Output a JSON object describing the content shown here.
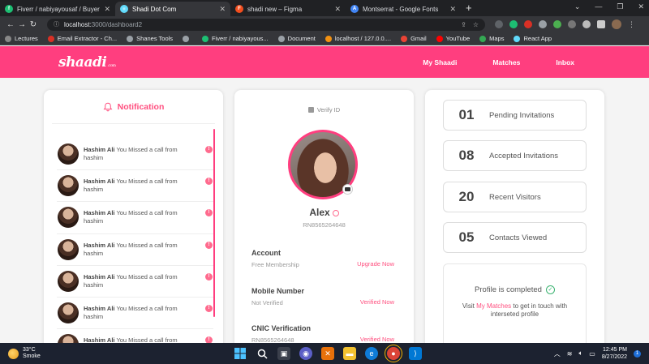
{
  "browser": {
    "tabs": [
      {
        "title": "Fiverr / nabiyayousaf / Buyer Rep",
        "icon": "fiverr-icon",
        "color": "#1dbf73",
        "glyph": "f",
        "active": false
      },
      {
        "title": "Shadi Dot Com",
        "icon": "react-icon",
        "color": "#61dafb",
        "glyph": "⚛",
        "active": true
      },
      {
        "title": "shadi new – Figma",
        "icon": "figma-icon",
        "color": "#f24e1e",
        "glyph": "F",
        "active": false
      },
      {
        "title": "Montserrat - Google Fonts",
        "icon": "google-fonts-icon",
        "color": "#4285f4",
        "glyph": "A",
        "active": false
      }
    ],
    "url_host": "localhost:",
    "url_path": "3000/dashboard2",
    "bookmarks": [
      {
        "label": "Lectures",
        "color": "#888"
      },
      {
        "label": "Email Extractor - Ch...",
        "color": "#d93025"
      },
      {
        "label": "Shanes Tools",
        "color": "#9aa0a6"
      },
      {
        "label": "",
        "color": "#9aa0a6"
      },
      {
        "label": "Fiverr / nabiyayous...",
        "color": "#1dbf73"
      },
      {
        "label": "Document",
        "color": "#9aa0a6"
      },
      {
        "label": "localhost / 127.0.0....",
        "color": "#f29111"
      },
      {
        "label": "Gmail",
        "color": "#ea4335"
      },
      {
        "label": "YouTube",
        "color": "#ff0000"
      },
      {
        "label": "Maps",
        "color": "#34a853"
      },
      {
        "label": "React App",
        "color": "#61dafb"
      }
    ]
  },
  "app": {
    "logo": "shaadi",
    "logo_suffix": ".com",
    "nav": [
      "My Shaadi",
      "Matches",
      "Inbox"
    ],
    "accent": "#ff3e7f"
  },
  "notification": {
    "title": "Notification",
    "items": [
      {
        "name": "Hashim Ali",
        "message": "You Missed a call from hashim",
        "badge": "!"
      },
      {
        "name": "Hashim Ali",
        "message": "You Missed a call from hashim",
        "badge": "!"
      },
      {
        "name": "Hashim Ali",
        "message": "You Missed a call from hashim",
        "badge": "!"
      },
      {
        "name": "Hashim Ali",
        "message": "You Missed a call from hashim",
        "badge": "!"
      },
      {
        "name": "Hashim Ali",
        "message": "You Missed a call from hashim",
        "badge": "!"
      },
      {
        "name": "Hashim Ali",
        "message": "You Missed a call from hashim",
        "badge": "!"
      },
      {
        "name": "Hashim Ali",
        "message": "You Missed a call from hashim",
        "badge": "!"
      }
    ]
  },
  "profile": {
    "verify": "Verify ID",
    "name": "Alex",
    "id": "RN8565264648",
    "rows": [
      {
        "label": "Account",
        "value": "Free Membership",
        "action": "Upgrade Now"
      },
      {
        "label": "Mobile Number",
        "value": "Not Verified",
        "action": "Verified Now"
      },
      {
        "label": "CNIC Verification",
        "value": "RN8565264648",
        "action": "Verified Now"
      }
    ]
  },
  "stats": [
    {
      "num": "01",
      "label": "Pending Invitations"
    },
    {
      "num": "08",
      "label": "Accepted Invitations"
    },
    {
      "num": "20",
      "label": "Recent Visitors"
    },
    {
      "num": "05",
      "label": "Contacts Viewed"
    }
  ],
  "completion": {
    "title": "Profile is completed",
    "text_before": "Visit ",
    "link": "My Matches",
    "text_after": " to get in touch with interseted profile"
  },
  "taskbar": {
    "temp": "33°C",
    "weather": "Smoke",
    "time": "12:45 PM",
    "date": "8/27/2022",
    "notif_count": "1"
  }
}
